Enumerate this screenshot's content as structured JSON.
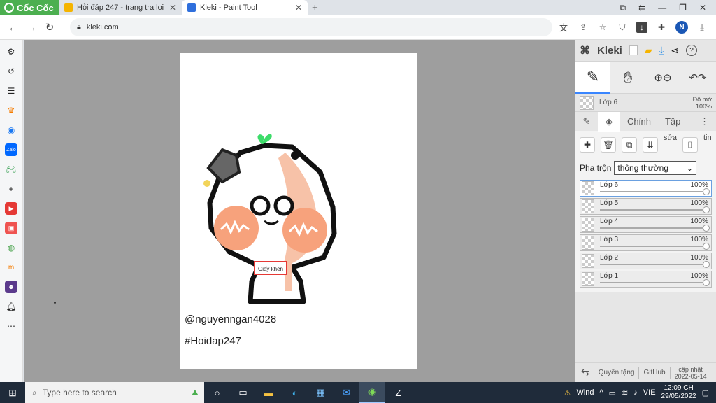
{
  "browser": {
    "brand": "Cốc Cốc",
    "tabs": [
      {
        "title": "Hỏi đáp 247 - trang tra loi",
        "active": false
      },
      {
        "title": "Kleki - Paint Tool",
        "active": true
      }
    ],
    "new_tab": "+",
    "url": "kleki.com"
  },
  "canvas": {
    "text_line1": "@nguyenngan4028",
    "text_line2": "#Hoidap247",
    "sticker_label": "Giấy khen"
  },
  "kleki": {
    "title": "Kleki",
    "current_layer": "Lớp 6",
    "opacity_label_1": "Độ mờ",
    "opacity_label_2": "100%",
    "tabs": [
      "Chỉnh",
      "Tập"
    ],
    "action_labels": [
      "sửa",
      "tin"
    ],
    "blend_label": "Pha trộn",
    "blend_value": "thông thường",
    "layers": [
      {
        "name": "Lớp 6",
        "opacity": "100%",
        "value": 1.0,
        "selected": true
      },
      {
        "name": "Lớp 5",
        "opacity": "100%",
        "value": 1.0,
        "selected": false
      },
      {
        "name": "Lớp 4",
        "opacity": "100%",
        "value": 1.0,
        "selected": false
      },
      {
        "name": "Lớp 3",
        "opacity": "100%",
        "value": 1.0,
        "selected": false
      },
      {
        "name": "Lớp 2",
        "opacity": "100%",
        "value": 1.0,
        "selected": false
      },
      {
        "name": "Lớp 1",
        "opacity": "100%",
        "value": 1.0,
        "selected": false
      }
    ],
    "footer": {
      "donate": "Quyên tặng",
      "github": "GitHub",
      "updated_1": "cập nhật",
      "updated_2": "2022-05-14"
    }
  },
  "taskbar": {
    "search_placeholder": "Type here to search",
    "weather": "Wind",
    "lang": "VIE",
    "time": "12:09 CH",
    "date": "29/05/2022"
  },
  "colors": {
    "brand_green": "#4caf50",
    "accent_blue": "#3a86ff",
    "peach": "#f7a27c",
    "leaf": "#3ddc6a"
  }
}
